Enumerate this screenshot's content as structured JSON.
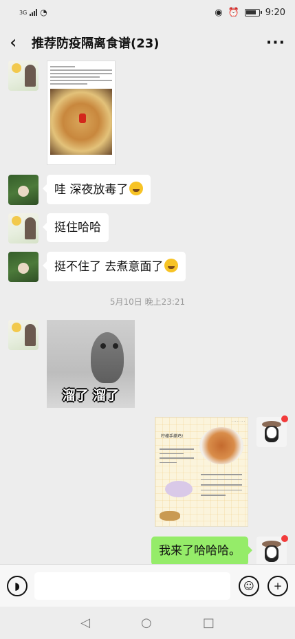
{
  "status_bar": {
    "network": "3G",
    "time": "9:20"
  },
  "header": {
    "title": "推荐防疫隔离食谱(23)"
  },
  "messages": [
    {
      "type": "image",
      "side": "left",
      "avatar": "avatar-girl-flower",
      "image": "noodle-recipe-document"
    },
    {
      "type": "text",
      "side": "left",
      "avatar": "avatar-cat-green",
      "text": "哇 深夜放毒了",
      "emoji": "crying-laughing-emoji"
    },
    {
      "type": "text",
      "side": "left",
      "avatar": "avatar-girl-flower",
      "text": "挺住哈哈"
    },
    {
      "type": "text",
      "side": "left",
      "avatar": "avatar-cat-green",
      "text": "挺不住了 去煮意面了",
      "emoji": "crying-laughing-emoji"
    },
    {
      "type": "time",
      "text": "5月10日 晚上23:21"
    },
    {
      "type": "image",
      "side": "left",
      "avatar": "avatar-girl-flower",
      "image": "owl-sticker",
      "caption": "溜了 溜了"
    },
    {
      "type": "image",
      "side": "right",
      "avatar": "avatar-hat-girl",
      "image": "lemon-chicken-recipe-card",
      "image_title": "柠檬手撕鸡!"
    },
    {
      "type": "text",
      "side": "right",
      "avatar": "avatar-hat-girl",
      "text": "我来了哈哈哈。"
    }
  ],
  "input": {
    "placeholder": ""
  },
  "colors": {
    "background": "#ededed",
    "sent_bubble": "#95ec69",
    "received_bubble": "#ffffff",
    "unread_dot": "#f23b3b"
  }
}
